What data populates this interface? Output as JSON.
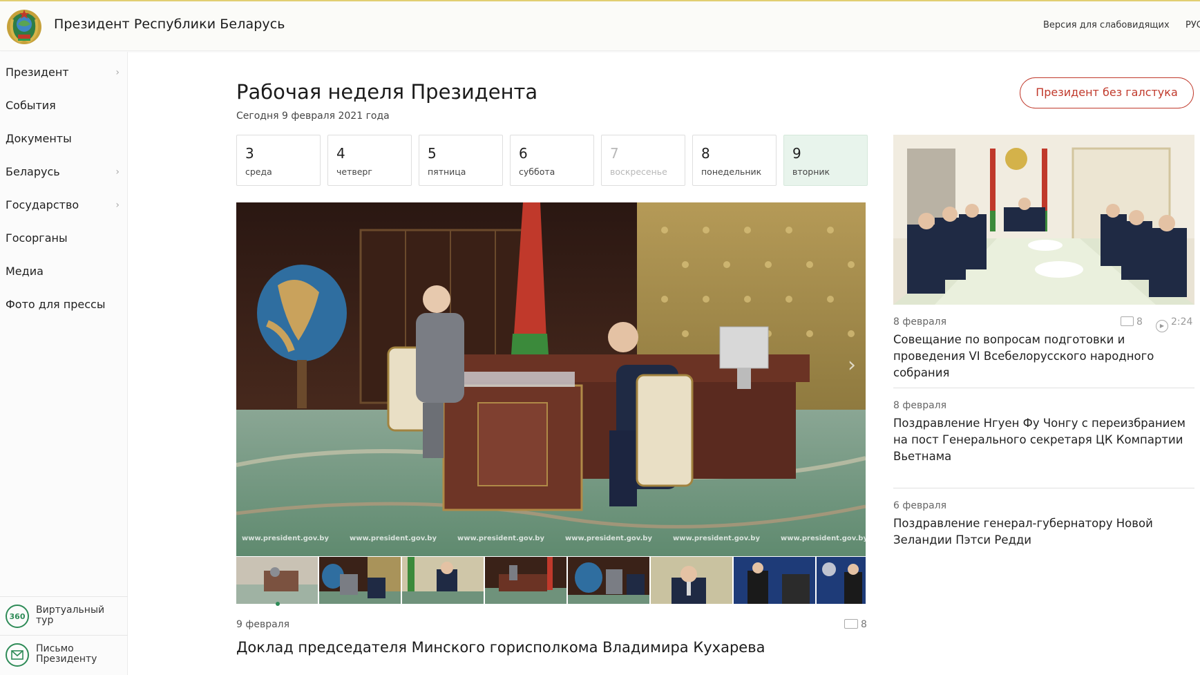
{
  "header": {
    "site_title": "Президент Республики Беларусь",
    "vision_link": "Версия для слабовидящих",
    "language": "РУС"
  },
  "sidebar": {
    "items": [
      {
        "label": "Президент",
        "has_children": true
      },
      {
        "label": "События",
        "has_children": false
      },
      {
        "label": "Документы",
        "has_children": false
      },
      {
        "label": "Беларусь",
        "has_children": true
      },
      {
        "label": "Государство",
        "has_children": true
      },
      {
        "label": "Госорганы",
        "has_children": false
      },
      {
        "label": "Медиа",
        "has_children": false
      },
      {
        "label": "Фото для прессы",
        "has_children": false
      }
    ],
    "chevron": "›",
    "virtual_tour": {
      "icon_text": "360",
      "label": "Виртуальный тур"
    },
    "letter": {
      "icon": "envelope-icon",
      "label": "Письмо Президенту"
    }
  },
  "main": {
    "title": "Рабочая неделя Президента",
    "today": "Сегодня 9 февраля 2021 года",
    "no_tie_button": "Президент без галстука",
    "days": [
      {
        "num": "3",
        "name": "среда",
        "state": "normal"
      },
      {
        "num": "4",
        "name": "четверг",
        "state": "normal"
      },
      {
        "num": "5",
        "name": "пятница",
        "state": "normal"
      },
      {
        "num": "6",
        "name": "суббота",
        "state": "normal"
      },
      {
        "num": "7",
        "name": "воскресенье",
        "state": "disabled"
      },
      {
        "num": "8",
        "name": "понедельник",
        "state": "normal"
      },
      {
        "num": "9",
        "name": "вторник",
        "state": "active"
      }
    ],
    "watermark": "www.president.gov.by",
    "photo_arrow": "›",
    "featured": {
      "date": "9 февраля",
      "photo_count": "8",
      "headline": "Доклад председателя Минского горисполкома Владимира Кухарева"
    }
  },
  "news": [
    {
      "date": "8 февраля",
      "photo_count": "8",
      "video_duration": "2:24",
      "title": "Совещание по вопросам подготовки и проведения VI Всебелорусского народного собрания"
    },
    {
      "date": "8 февраля",
      "title": "Поздравление Нгуен Фу Чонгу с переизбранием на пост Генерального секретаря ЦК Компартии Вьетнама"
    },
    {
      "date": "6 февраля",
      "title": "Поздравление генерал-губернатору Новой Зеландии Пэтси Редди"
    }
  ],
  "colors": {
    "accent_red": "#c0392b",
    "accent_green": "#2e8b57",
    "active_day_bg": "#e8f4ec"
  }
}
